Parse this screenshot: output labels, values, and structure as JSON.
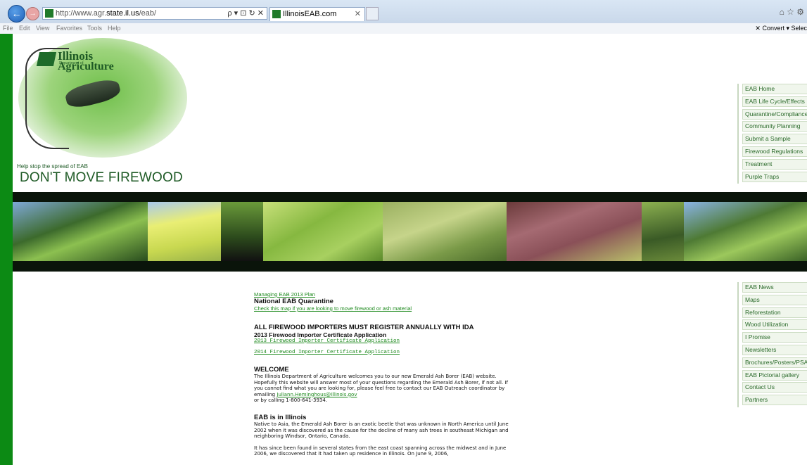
{
  "browser": {
    "url_prefix": "http://www.agr.",
    "url_host": "state.il.us",
    "url_suffix": "/eab/",
    "tab_title": "IllinoisEAB.com",
    "address_tools": "ρ ▾ ⊡ ↻ ✕",
    "menu": [
      "File",
      "Edit",
      "View",
      "Favorites",
      "Tools",
      "Help"
    ],
    "toolbar_right": "✕   Convert ▾   Selec"
  },
  "header": {
    "logo_line1": "Illinois",
    "logo_line2": "Department of",
    "logo_line3": "Agriculture",
    "tagline_small": "Help stop the spread of EAB",
    "tagline_big": "DON'T MOVE FIREWOOD"
  },
  "nav_top": [
    "EAB Home",
    "EAB Life Cycle/Effects",
    "Quarantine/Compliance",
    "Community Planning",
    "Submit a Sample",
    "Firewood Regulations",
    "Treatment",
    "Purple Traps"
  ],
  "nav_bottom": [
    "EAB News",
    "Maps",
    "Reforestation",
    "Wood Utilization",
    "I Promise",
    "Newsletters",
    "Brochures/Posters/PSAs",
    "EAB Pictorial gallery",
    "Contact Us",
    "Partners"
  ],
  "content": {
    "plan_link": "Managing EAB 2013 Plan",
    "quarantine_title": "National EAB Quarantine",
    "quarantine_link": "Check this map if you are looking to move firewood or ash material",
    "importers_title": "ALL FIREWOOD IMPORTERS MUST REGISTER ANNUALLY WITH IDA",
    "importers_subtitle": "2013 Firewood Importer Certificate Application",
    "link_2013": "2013 Firewood Importer Certificate Application",
    "link_2014": "2014 Firewood Importer Certificate Application",
    "welcome_title": "WELCOME",
    "welcome_text": "The Illinois Department of Agriculture welcomes you to our new Emerald Ash Borer (EAB) website. Hopefully this website will answer most of your questions regarding the Emerald Ash Borer, if not all. If you cannot find what you are looking for, please feel free to contact our EAB Outreach coordinator by emailing",
    "welcome_email": "Juliann.Heminghous@Illinois.gov",
    "welcome_phone": "or by calling 1-800-641-3934.",
    "illinois_title": "EAB is in Illinois",
    "illinois_text": "Native to Asia, the Emerald Ash Borer is an exotic beetle that was unknown in North America until June 2002 when it was discovered as the cause for the decline of many ash trees in southeast Michigan and neighboring Windsor, Ontario, Canada.",
    "spread_text": "It has since been found in several states from the east coast spanning across the midwest and in June 2006, we discovered that it had taken up residence in Illinois. On June 9, 2006,"
  },
  "colors": {
    "frame_green": "#0c8a14",
    "brand_green": "#1e5a25",
    "link_green": "#1e8a1e"
  }
}
